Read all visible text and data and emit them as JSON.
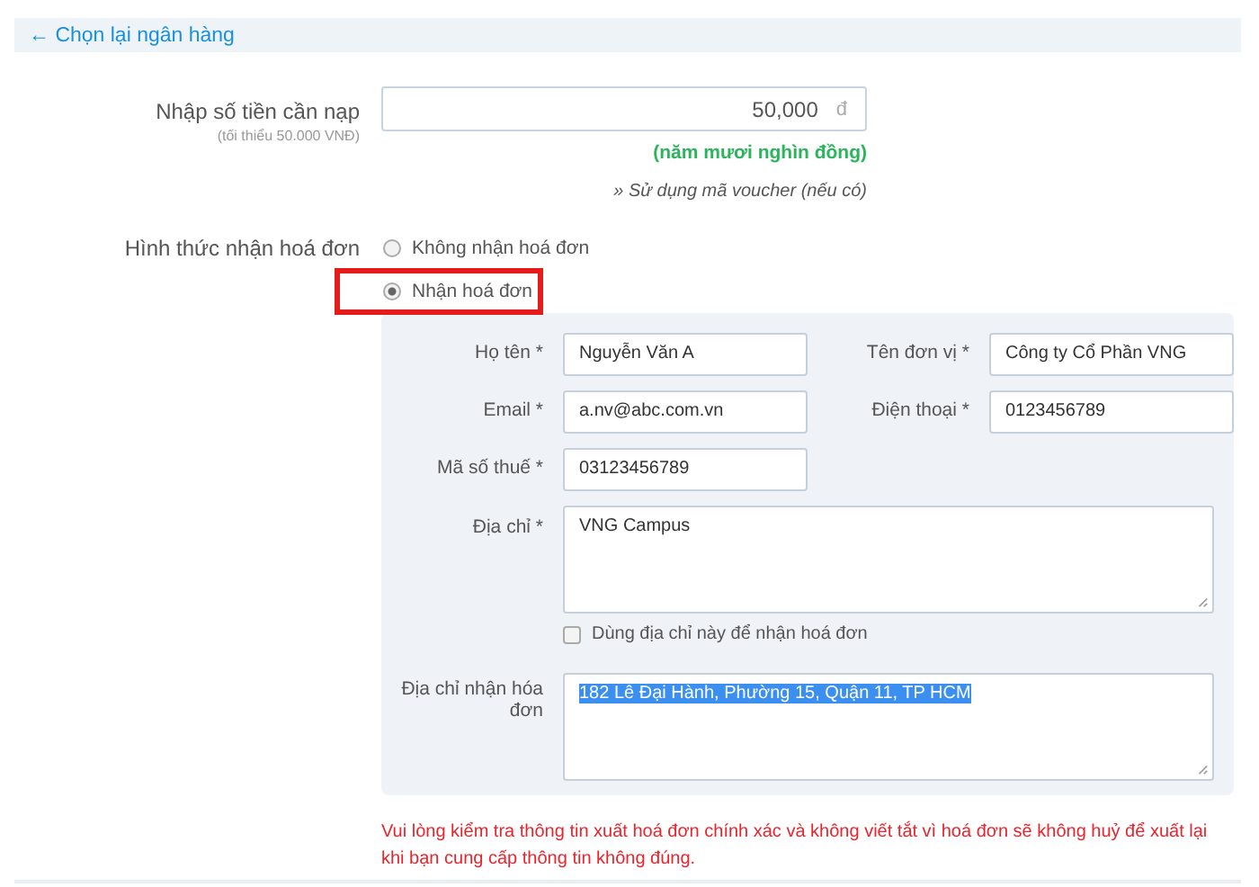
{
  "back_link": "← Chọn lại ngân hàng",
  "amount": {
    "label": "Nhập số tiền cần nạp",
    "hint": "(tối thiểu 50.000 VNĐ)",
    "value": "50,000",
    "currency": "đ",
    "in_words": "(năm mươi nghìn đồng)",
    "voucher_link": "» Sử dụng mã voucher (nếu có)"
  },
  "invoice": {
    "label": "Hình thức nhận hoá đơn",
    "options": [
      {
        "label": "Không nhận hoá đơn",
        "selected": false,
        "highlighted": false
      },
      {
        "label": "Nhận hoá đơn",
        "selected": true,
        "highlighted": true
      }
    ],
    "fields": [
      {
        "label": "Họ tên *",
        "value": "Nguyễn Văn A"
      },
      {
        "label": "Tên đơn vị *",
        "value": "Công ty Cổ Phần VNG"
      },
      {
        "label": "Email *",
        "value": "a.nv@abc.com.vn"
      },
      {
        "label": "Điện thoại *",
        "value": "0123456789"
      },
      {
        "label": "Mã số thuế *",
        "value": "03123456789"
      }
    ],
    "address": {
      "label": "Địa chỉ *",
      "value": "VNG Campus"
    },
    "use_address": {
      "label": "Dùng địa chỉ này để nhận hoá đơn",
      "checked": false
    },
    "receive_address": {
      "label": "Địa chỉ nhận hóa đơn",
      "value": "182 Lê Đại Hành, Phường 15, Quận 11, TP HCM",
      "text_selected": true
    }
  },
  "warning": "Vui lòng kiểm tra thông tin xuất hoá đơn chính xác và không viết tắt vì hoá đơn sẽ không huỷ để xuất lại khi bạn cung cấp thông tin không đúng."
}
